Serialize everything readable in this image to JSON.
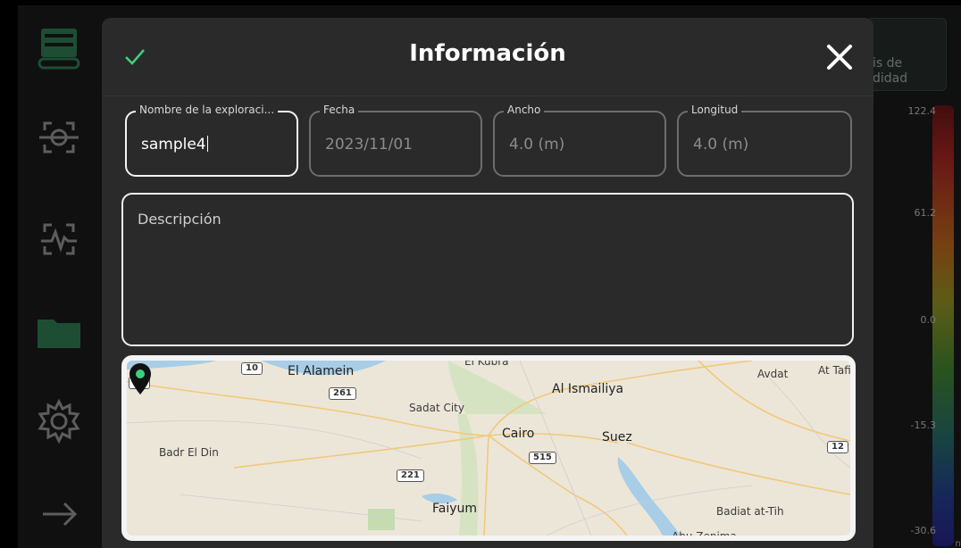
{
  "dialog": {
    "title": "Información",
    "fields": [
      {
        "label": "Nombre de la exploraci...",
        "value": "sample4"
      },
      {
        "label": "Fecha",
        "value": "2023/11/01"
      },
      {
        "label": "Ancho",
        "value": "4.0 (m)"
      },
      {
        "label": "Longitud",
        "value": "4.0 (m)"
      }
    ],
    "description_label": "Descripción"
  },
  "background": {
    "analysis_text": "is de\ndidad",
    "scale_labels": [
      "122.4",
      "61.2",
      "0.0",
      "-15.3",
      "-30.6"
    ],
    "scale_unit": "nT"
  },
  "map": {
    "cities": [
      "El Alamein",
      "El Kubra",
      "Avdat",
      "At Tafi",
      "Al Ismailiya",
      "Sadat City",
      "Cairo",
      "Suez",
      "Badr El Din",
      "Faiyum",
      "Badiat at-Tih",
      "Abu Zenima"
    ],
    "shields": [
      "10",
      "19",
      "261",
      "515",
      "221",
      "12"
    ]
  },
  "colors": {
    "accent_green": "#3ecf7d",
    "dialog_bg": "#2a2a2b"
  },
  "icons": {
    "sidebar": [
      "scanner-icon",
      "scan-target-icon",
      "scan-signal-icon",
      "folder-icon",
      "settings-icon",
      "arrow-right-icon"
    ]
  }
}
